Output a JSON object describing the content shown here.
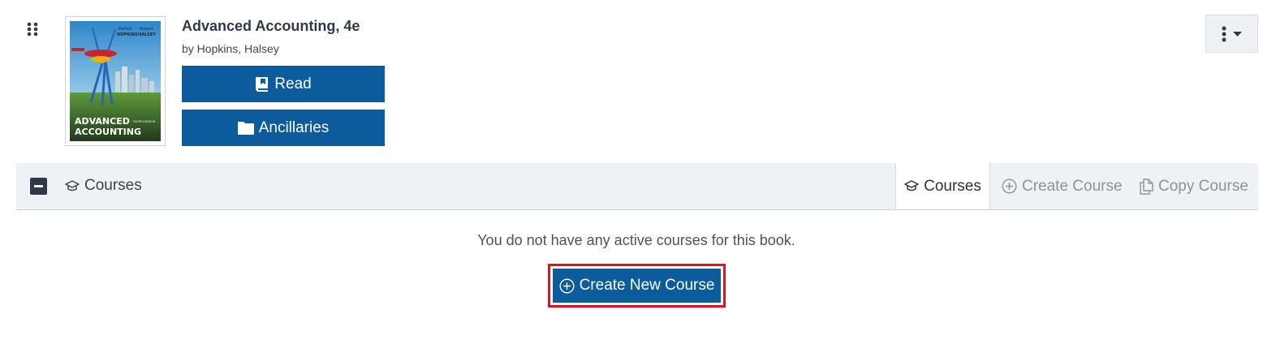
{
  "book": {
    "title": "Advanced Accounting, 4e",
    "author": "by Hopkins, Halsey",
    "cover": {
      "authors_line_1": "Patrick",
      "authors_line_1b": "Robert",
      "authors_line_2": "HOPKINS",
      "authors_line_2b": "HALSEY",
      "title_line_1": "ADVANCED",
      "title_line_2": "ACCOUNTING",
      "edition": "FOURTH EDITION"
    }
  },
  "actions": {
    "read_label": "Read",
    "ancillaries_label": "Ancillaries"
  },
  "courses_bar": {
    "label": "Courses",
    "tabs": {
      "courses": "Courses",
      "create_course": "Create Course",
      "copy_course": "Copy Course"
    }
  },
  "empty_state": {
    "message": "You do not have any active courses for this book.",
    "create_label": "Create New Course"
  },
  "colors": {
    "primary": "#0c5b9c",
    "highlight": "#e0141e",
    "muted_text": "#8a939c"
  },
  "icons": [
    "drag-handle-icon",
    "book-open-icon",
    "folder-icon",
    "kebab-icon",
    "caret-down-icon",
    "graduation-cap-icon",
    "plus-circle-icon",
    "copy-icon"
  ]
}
